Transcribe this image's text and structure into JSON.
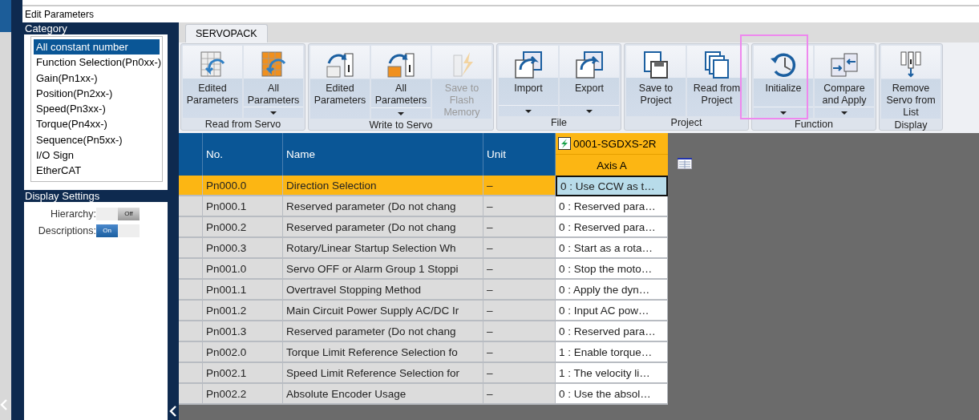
{
  "window": {
    "title": "Edit Parameters"
  },
  "category": {
    "title": "Category",
    "items": [
      {
        "label": "All constant number",
        "selected": true
      },
      {
        "label": "Function Selection(Pn0xx-)",
        "selected": false
      },
      {
        "label": "Gain(Pn1xx-)",
        "selected": false
      },
      {
        "label": "Position(Pn2xx-)",
        "selected": false
      },
      {
        "label": "Speed(Pn3xx-)",
        "selected": false
      },
      {
        "label": "Torque(Pn4xx-)",
        "selected": false
      },
      {
        "label": "Sequence(Pn5xx-)",
        "selected": false
      },
      {
        "label": "I/O Sign",
        "selected": false
      },
      {
        "label": "EtherCAT",
        "selected": false
      }
    ]
  },
  "display_settings": {
    "title": "Display Settings",
    "toggles": [
      {
        "label": "Hierarchy:",
        "on": false,
        "state_label": "Off"
      },
      {
        "label": "Descriptions:",
        "on": true,
        "state_label": "On"
      }
    ]
  },
  "tabs": [
    {
      "label": "SERVOPACK",
      "selected": true
    }
  ],
  "ribbon": [
    {
      "label": "Read from Servo",
      "buttons": [
        {
          "label": "Edited Parameters",
          "dropdown": false,
          "disabled": false,
          "highlighted": false
        },
        {
          "label": "All Parameters",
          "dropdown": true,
          "disabled": false,
          "highlighted": false
        }
      ]
    },
    {
      "label": "Write to Servo",
      "buttons": [
        {
          "label": "Edited Parameters",
          "dropdown": false,
          "disabled": false,
          "highlighted": false
        },
        {
          "label": "All Parameters",
          "dropdown": true,
          "disabled": false,
          "highlighted": false
        },
        {
          "label": "Save to Flash Memory",
          "dropdown": false,
          "disabled": true,
          "highlighted": false
        }
      ]
    },
    {
      "label": "File",
      "buttons": [
        {
          "label": "Import",
          "dropdown": true,
          "disabled": false,
          "highlighted": false
        },
        {
          "label": "Export",
          "dropdown": true,
          "disabled": false,
          "highlighted": false
        }
      ]
    },
    {
      "label": "Project",
      "buttons": [
        {
          "label": "Save to Project",
          "dropdown": false,
          "disabled": false,
          "highlighted": false
        },
        {
          "label": "Read from Project",
          "dropdown": false,
          "disabled": false,
          "highlighted": false
        }
      ]
    },
    {
      "label": "Function",
      "buttons": [
        {
          "label": "Initialize",
          "dropdown": true,
          "disabled": false,
          "highlighted": true
        },
        {
          "label": "Compare and Apply",
          "dropdown": true,
          "disabled": false,
          "highlighted": false
        }
      ]
    },
    {
      "label": "Display",
      "buttons": [
        {
          "label": "Remove Servo from List",
          "dropdown": false,
          "disabled": false,
          "highlighted": false
        }
      ]
    }
  ],
  "table": {
    "columns": [
      "No.",
      "Name",
      "Unit"
    ],
    "device": "0001-SGDXS-2R",
    "axis": "Axis A",
    "rows": [
      {
        "no": "Pn000.0",
        "name": "Direction Selection",
        "unit": "–",
        "value": "0 : Use CCW as t…",
        "selected": true
      },
      {
        "no": "Pn000.1",
        "name": "Reserved parameter (Do not chang",
        "unit": "–",
        "value": "0 : Reserved para…",
        "selected": false
      },
      {
        "no": "Pn000.2",
        "name": "Reserved parameter (Do not chang",
        "unit": "–",
        "value": "0 : Reserved para…",
        "selected": false
      },
      {
        "no": "Pn000.3",
        "name": "Rotary/Linear Startup Selection Wh",
        "unit": "–",
        "value": "0 : Start as a rota…",
        "selected": false
      },
      {
        "no": "Pn001.0",
        "name": "Servo OFF or Alarm Group 1 Stoppi",
        "unit": "–",
        "value": "0 : Stop the moto…",
        "selected": false
      },
      {
        "no": "Pn001.1",
        "name": "Overtravel Stopping Method",
        "unit": "–",
        "value": "0 : Apply the dyn…",
        "selected": false
      },
      {
        "no": "Pn001.2",
        "name": "Main Circuit Power Supply AC/DC Ir",
        "unit": "–",
        "value": "0 : Input AC pow…",
        "selected": false
      },
      {
        "no": "Pn001.3",
        "name": "Reserved parameter (Do not chang",
        "unit": "–",
        "value": "0 : Reserved para…",
        "selected": false
      },
      {
        "no": "Pn002.0",
        "name": "Torque Limit Reference Selection fo",
        "unit": "–",
        "value": "1 : Enable torque…",
        "selected": false
      },
      {
        "no": "Pn002.1",
        "name": "Speed Limit Reference Selection for",
        "unit": "–",
        "value": "1 : The velocity li…",
        "selected": false
      },
      {
        "no": "Pn002.2",
        "name": "Absolute Encoder Usage",
        "unit": "–",
        "value": "0 : Use the absol…",
        "selected": false
      }
    ]
  }
}
